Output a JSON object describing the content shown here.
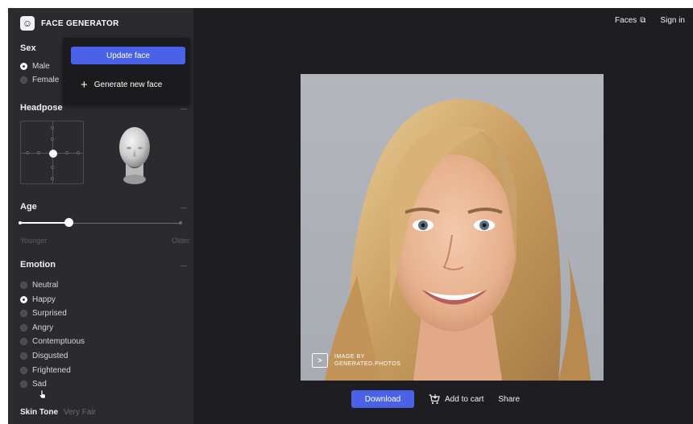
{
  "brand": {
    "title": "FACE GENERATOR"
  },
  "sidebar": {
    "sex": {
      "title": "Sex",
      "options": [
        {
          "label": "Male",
          "selected": true
        },
        {
          "label": "Female",
          "selected": false
        }
      ]
    },
    "popup": {
      "update_label": "Update face",
      "generate_label": "Generate new face"
    },
    "headpose": {
      "title": "Headpose"
    },
    "age": {
      "title": "Age",
      "min_label": "Younger",
      "max_label": "Older",
      "value_fraction": 0.3
    },
    "emotion": {
      "title": "Emotion",
      "options": [
        {
          "label": "Neutral",
          "selected": false
        },
        {
          "label": "Happy",
          "selected": true
        },
        {
          "label": "Surprised",
          "selected": false
        },
        {
          "label": "Angry",
          "selected": false
        },
        {
          "label": "Contemptuous",
          "selected": false
        },
        {
          "label": "Disgusted",
          "selected": false
        },
        {
          "label": "Frightened",
          "selected": false
        },
        {
          "label": "Sad",
          "selected": false
        }
      ]
    },
    "skin_tone": {
      "title": "Skin Tone",
      "value": "Very Fair"
    }
  },
  "topnav": {
    "faces_label": "Faces",
    "signin_label": "Sign in"
  },
  "photo": {
    "watermark_line1": "IMAGE BY",
    "watermark_line2": "GENERATED.PHOTOS"
  },
  "actions": {
    "download_label": "Download",
    "cart_label": "Add to cart",
    "share_label": "Share"
  },
  "colors": {
    "accent": "#4a62e8",
    "sidebar_bg": "#2b2b2f",
    "main_bg": "#1e1e22"
  }
}
